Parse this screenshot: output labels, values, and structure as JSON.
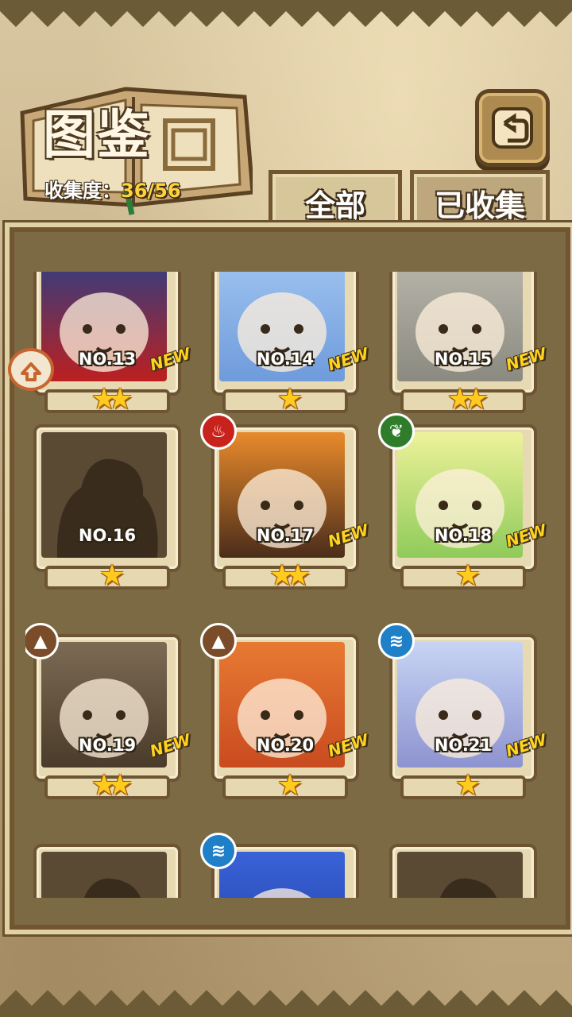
{
  "header": {
    "title": "图鉴",
    "collect_label": "收集度：",
    "collect_value": "36/56",
    "back_icon": "return-arrow-icon"
  },
  "tabs": [
    {
      "label": "全部",
      "active": true
    },
    {
      "label": "已收集",
      "active": false
    }
  ],
  "cards": [
    {
      "no": "NO.13",
      "stars": "★★",
      "new": "NEW",
      "element": ""
    },
    {
      "no": "NO.14",
      "stars": "★",
      "new": "NEW",
      "element": ""
    },
    {
      "no": "NO.15",
      "stars": "★★",
      "new": "NEW",
      "element": ""
    },
    {
      "no": "NO.16",
      "stars": "★",
      "new": "",
      "element": "",
      "silhouette": true
    },
    {
      "no": "NO.17",
      "stars": "★★",
      "new": "NEW",
      "element": "fire"
    },
    {
      "no": "NO.18",
      "stars": "★",
      "new": "NEW",
      "element": "leaf"
    },
    {
      "no": "NO.19",
      "stars": "★★",
      "new": "NEW",
      "element": "earth"
    },
    {
      "no": "NO.20",
      "stars": "★",
      "new": "NEW",
      "element": "earth"
    },
    {
      "no": "NO.21",
      "stars": "★",
      "new": "NEW",
      "element": "water"
    },
    {
      "no": "",
      "stars": "",
      "new": "",
      "element": "",
      "silhouette": true
    },
    {
      "no": "",
      "stars": "",
      "new": "",
      "element": "water"
    },
    {
      "no": "",
      "stars": "",
      "new": "",
      "element": "",
      "silhouette": true
    }
  ],
  "colors": {
    "panel": "#7c6a44",
    "frame": "#e7d9b2",
    "star": "#ffcb1f",
    "new": "#ffd31d"
  }
}
